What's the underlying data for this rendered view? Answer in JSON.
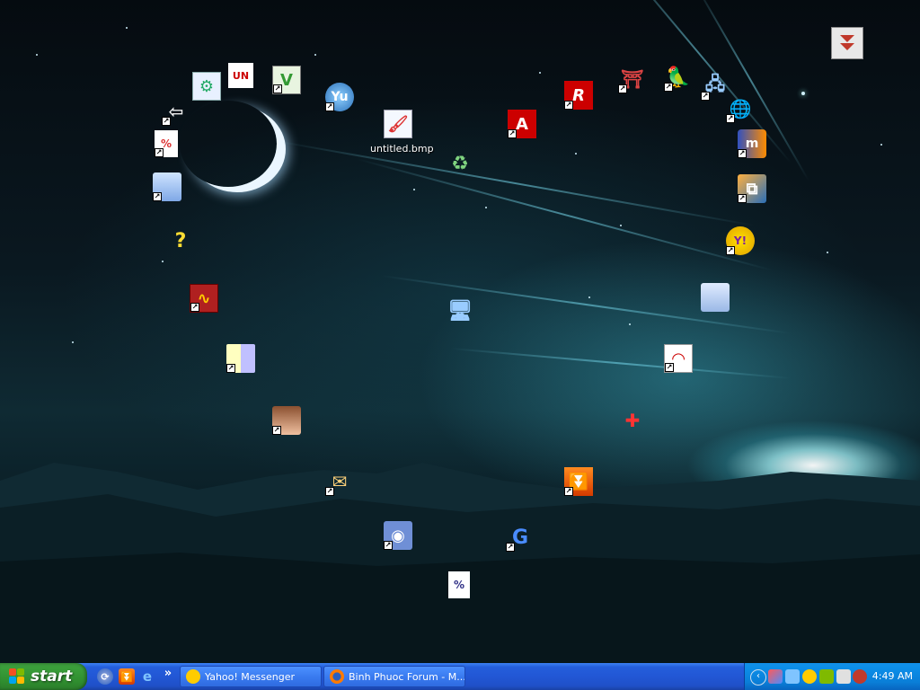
{
  "desktop": {
    "icons": [
      {
        "name": "untitled.bmp",
        "label": "untitled.bmp",
        "glyph": "🖌"
      },
      {
        "name": "recycle-bin",
        "glyph": "♻"
      },
      {
        "name": "my-computer",
        "glyph": "🖥"
      },
      {
        "name": "adobe-reader",
        "glyph": "A"
      },
      {
        "name": "avira",
        "glyph": "R"
      },
      {
        "name": "yahoo-messenger",
        "glyph": "Y!"
      }
    ],
    "top_right_button_icon": "double-chevron-down-icon"
  },
  "taskbar": {
    "start_label": "start",
    "quick_launch_more": "»",
    "tasks": [
      {
        "label": "Yahoo! Messenger",
        "icon": "yahoo-smiley-icon",
        "color": "#ffcc00"
      },
      {
        "label": "Binh Phuoc Forum - M...",
        "icon": "firefox-icon",
        "color": "#ff7a00"
      }
    ],
    "clock": "4:49 AM"
  },
  "colors": {
    "taskbar": "#245edb",
    "start": "#3a9e3a",
    "tray": "#0c8ee8"
  }
}
